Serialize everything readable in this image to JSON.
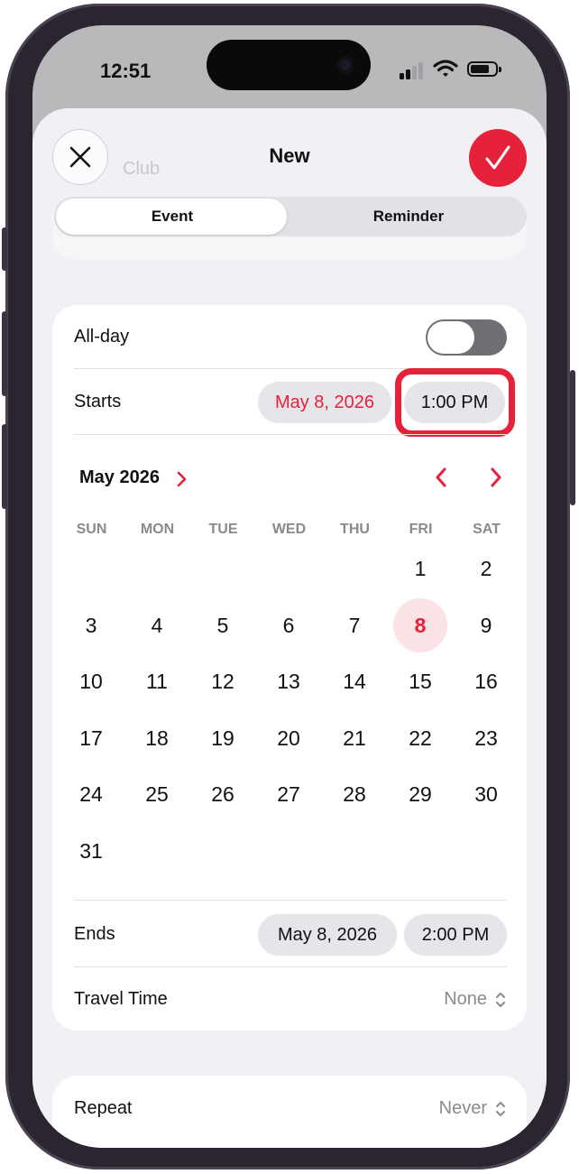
{
  "status_bar": {
    "time": "12:51"
  },
  "header": {
    "title": "New",
    "ghost_text": "Club"
  },
  "segments": [
    {
      "label": "Event",
      "selected": true
    },
    {
      "label": "Reminder",
      "selected": false
    }
  ],
  "allday": {
    "label": "All-day",
    "on": false
  },
  "starts": {
    "label": "Starts",
    "date": "May 8, 2026",
    "time": "1:00 PM"
  },
  "calendar": {
    "month_label": "May 2026",
    "weekdays": [
      "SUN",
      "MON",
      "TUE",
      "WED",
      "THU",
      "FRI",
      "SAT"
    ],
    "days": [
      "1",
      "2",
      "3",
      "4",
      "5",
      "6",
      "7",
      "8",
      "9",
      "10",
      "11",
      "12",
      "13",
      "14",
      "15",
      "16",
      "17",
      "18",
      "19",
      "20",
      "21",
      "22",
      "23",
      "24",
      "25",
      "26",
      "27",
      "28",
      "29",
      "30",
      "31"
    ],
    "selected_day": "8"
  },
  "ends": {
    "label": "Ends",
    "date": "May 8, 2026",
    "time": "2:00 PM"
  },
  "travel_time": {
    "label": "Travel Time",
    "value": "None"
  },
  "repeat": {
    "label": "Repeat",
    "value": "Never"
  },
  "colors": {
    "accent": "#e5223a",
    "selected_day_bg": "#fbe3e6",
    "pill_bg": "#e5e5ea"
  }
}
